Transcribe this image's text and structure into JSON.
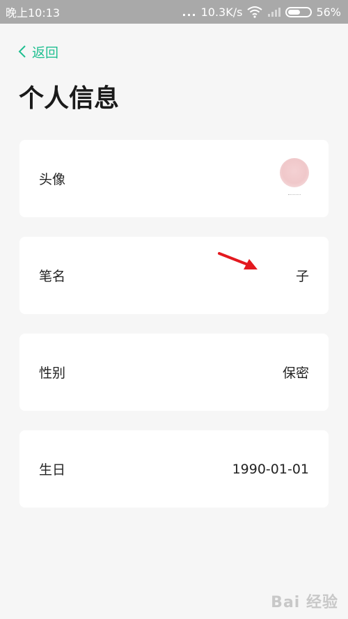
{
  "status_bar": {
    "time": "晚上10:13",
    "dots": "...",
    "network_speed": "10.3K/s",
    "battery_percent": "56%",
    "battery_level": 0.56,
    "wifi_icon": "wifi-icon",
    "signal_icon": "signal-icon"
  },
  "header": {
    "back_label": "返回",
    "back_icon": "chevron-left-icon",
    "title": "个人信息"
  },
  "fields": [
    {
      "label": "头像",
      "value": ""
    },
    {
      "label": "笔名",
      "value": "子"
    },
    {
      "label": "性别",
      "value": "保密"
    },
    {
      "label": "生日",
      "value": "1990-01-01"
    }
  ],
  "watermark": "Bai 经验",
  "colors": {
    "accent": "#1fbf90",
    "background": "#f6f6f6",
    "card": "#ffffff",
    "status_bar": "#a9a9a9",
    "annotation_arrow": "#e3191f"
  }
}
